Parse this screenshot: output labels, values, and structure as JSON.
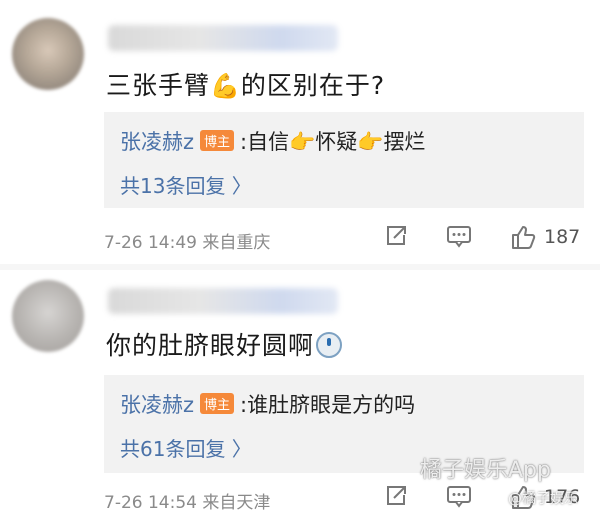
{
  "comments": [
    {
      "text": "三张手臂",
      "text_after": "的区别在于?",
      "emoji": "arm-icon",
      "reply": {
        "author": "张凌赫z",
        "badge": "博主",
        "prefix": ":自信",
        "mid1": "怀疑",
        "mid2": "摆烂"
      },
      "reply_count": "共13条回复 〉",
      "time": "7-26 14:49",
      "location": "来自重庆",
      "likes": "187"
    },
    {
      "text": "你的肚脐眼好圆啊",
      "emoji": "surprised-face-icon",
      "reply": {
        "author": "张凌赫z",
        "badge": "博主",
        "text": ":谁肚脐眼是方的吗"
      },
      "reply_count": "共61条回复 〉",
      "time": "7-26 14:54",
      "location": "来自天津",
      "likes": "176"
    }
  ],
  "watermark": {
    "main": "橘子娱乐App",
    "sub": "@橘子娱乐"
  },
  "colors": {
    "link": "#4b72a8",
    "badge": "#f5893a",
    "reply_bg": "#f2f2f2",
    "meta": "#8a8a8a"
  }
}
